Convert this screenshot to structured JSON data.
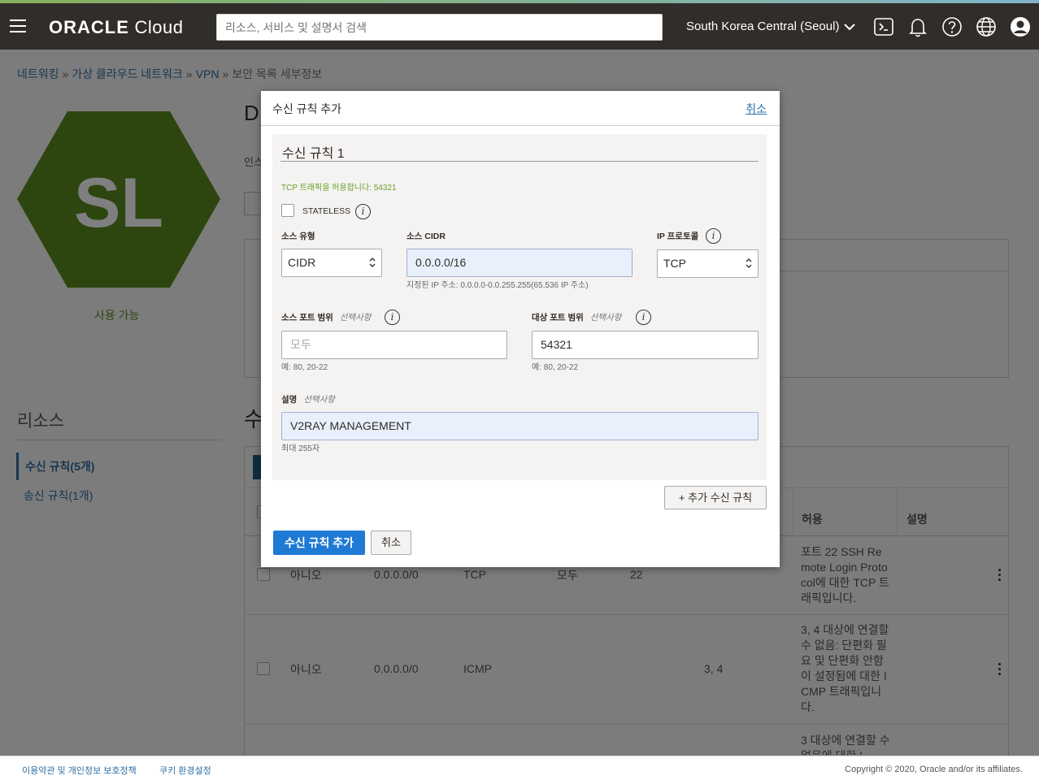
{
  "topbar": {
    "logo_bold": "ORACLE",
    "logo_light": "Cloud",
    "search_placeholder": "리소스, 서비스 및 설명서 검색",
    "region": "South Korea Central (Seoul)"
  },
  "breadcrumb": {
    "items": [
      "네트워킹",
      "가상 클라우드 네트워크",
      "VPN"
    ],
    "current": "보안 목록 세부정보",
    "separator": "»"
  },
  "page": {
    "avatar_initials": "SL",
    "status": "사용 가능",
    "title_fragment": "D",
    "info_fragment": "인스",
    "section_fragment": "수",
    "resources_title": "리소스",
    "resources": [
      {
        "label": "수신 규칙(5개)",
        "active": true
      },
      {
        "label": "송신 규칙(1개)",
        "active": false
      }
    ]
  },
  "table": {
    "headers": [
      "허용",
      "설명"
    ],
    "rows": [
      {
        "stateless": "아니오",
        "source": "0.0.0.0/0",
        "protocol": "TCP",
        "source_port": "모두",
        "dest_port": "22",
        "type_code": "",
        "allow": "포트 22 SSH Re mote Login Proto col에 대한 TCP 트래픽입니다."
      },
      {
        "stateless": "아니오",
        "source": "0.0.0.0/0",
        "protocol": "ICMP",
        "source_port": "",
        "dest_port": "",
        "type_code": "3, 4",
        "allow": "3, 4 대상에 연결할 수 없음: 단편화 필요 및 단편화 안함이 설정됨에 대한 ICMP 트래픽입니다."
      },
      {
        "stateless": "",
        "source": "",
        "protocol": "",
        "source_port": "",
        "dest_port": "",
        "type_code": "",
        "allow": "3 대상에 연결할 수 없음에 대한 I"
      }
    ]
  },
  "dialog": {
    "title": "수신 규칙 추가",
    "cancel_link": "취소",
    "rule_title": "수신 규칙 1",
    "tcp_message": "TCP 트래픽을 허용합니다: 54321",
    "stateless_label": "STATELESS",
    "stateless_checked": false,
    "source_type_label": "소스 유형",
    "source_type_value": "CIDR",
    "source_cidr_label": "소스 CIDR",
    "source_cidr_value": "0.0.0.0/16",
    "source_cidr_hint": "지정된 IP 주소: 0.0.0.0-0.0.255.255(65,536 IP 주소)",
    "ip_protocol_label": "IP 프로토콜",
    "ip_protocol_value": "TCP",
    "source_port_label": "소스 포트 범위",
    "optional": "선택사항",
    "source_port_placeholder": "모두",
    "source_port_hint": "예: 80, 20-22",
    "dest_port_label": "대상 포트 범위",
    "dest_port_value": "54321",
    "dest_port_hint": "예: 80, 20-22",
    "description_label": "설명",
    "description_value": "V2RAY MANAGEMENT",
    "description_hint": "최대 255자",
    "add_another_rule": "+ 추가 수신 규칙",
    "submit": "수신 규칙 추가",
    "cancel_button": "취소"
  },
  "footer": {
    "terms": "이용약관 및 개인정보 보호정책",
    "cookies": "쿠키 환경설정",
    "copyright": "Copyright © 2020, Oracle and/or its affiliates."
  },
  "colors": {
    "topbar": "#312d2a",
    "primary": "#1e7ad4",
    "hexagon": "#5a8d1e",
    "link": "#2e6fa3",
    "success_text": "#6aa12a"
  }
}
